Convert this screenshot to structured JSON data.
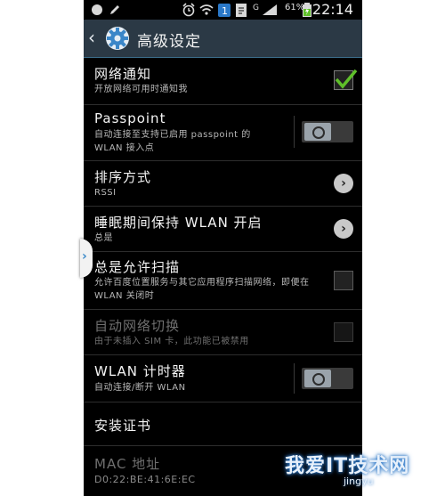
{
  "statusbar": {
    "time": "22:14",
    "battery": "61%",
    "signal_label": "G",
    "icons": [
      "notification-dot-icon",
      "edit-icon",
      "alarm-icon",
      "wifi-icon",
      "app-1-icon",
      "document-icon",
      "signal-icon",
      "battery-icon"
    ]
  },
  "header": {
    "back_icon": "‹",
    "title": "高级设定"
  },
  "rows": [
    {
      "title": "网络通知",
      "subtitle": "开放网络可用时通知我",
      "control": "checkbox",
      "checked": true
    },
    {
      "title": "Passpoint",
      "subtitle": "自动连接至支持已启用 passpoint 的 WLAN 接入点",
      "control": "toggle",
      "on": false
    },
    {
      "title": "排序方式",
      "subtitle": "RSSI",
      "control": "arrow"
    },
    {
      "title": "睡眠期间保持 WLAN 开启",
      "subtitle": "总是",
      "control": "arrow"
    },
    {
      "title": "总是允许扫描",
      "subtitle": "允许百度位置服务与其它应用程序扫描网络，即便在 WLAN 关闭时",
      "control": "checkbox",
      "checked": false
    },
    {
      "title": "自动网络切换",
      "subtitle": "由于未插入 SIM 卡，此功能已被禁用",
      "control": "checkbox",
      "checked": false,
      "disabled": true
    },
    {
      "title": "WLAN 计时器",
      "subtitle": "自动连接/断开 WLAN",
      "control": "toggle",
      "on": false
    },
    {
      "title": "安装证书",
      "subtitle": "",
      "control": "none"
    },
    {
      "title": "MAC 地址",
      "subtitle": "D0:22:BE:41:6E:EC",
      "control": "none",
      "disabled": true
    }
  ],
  "watermark": {
    "main": "我爱IT技术网",
    "sub": "jingyu"
  },
  "colors": {
    "actionbar": "#2b3945",
    "check": "#5fbf2a",
    "background": "#000000"
  }
}
